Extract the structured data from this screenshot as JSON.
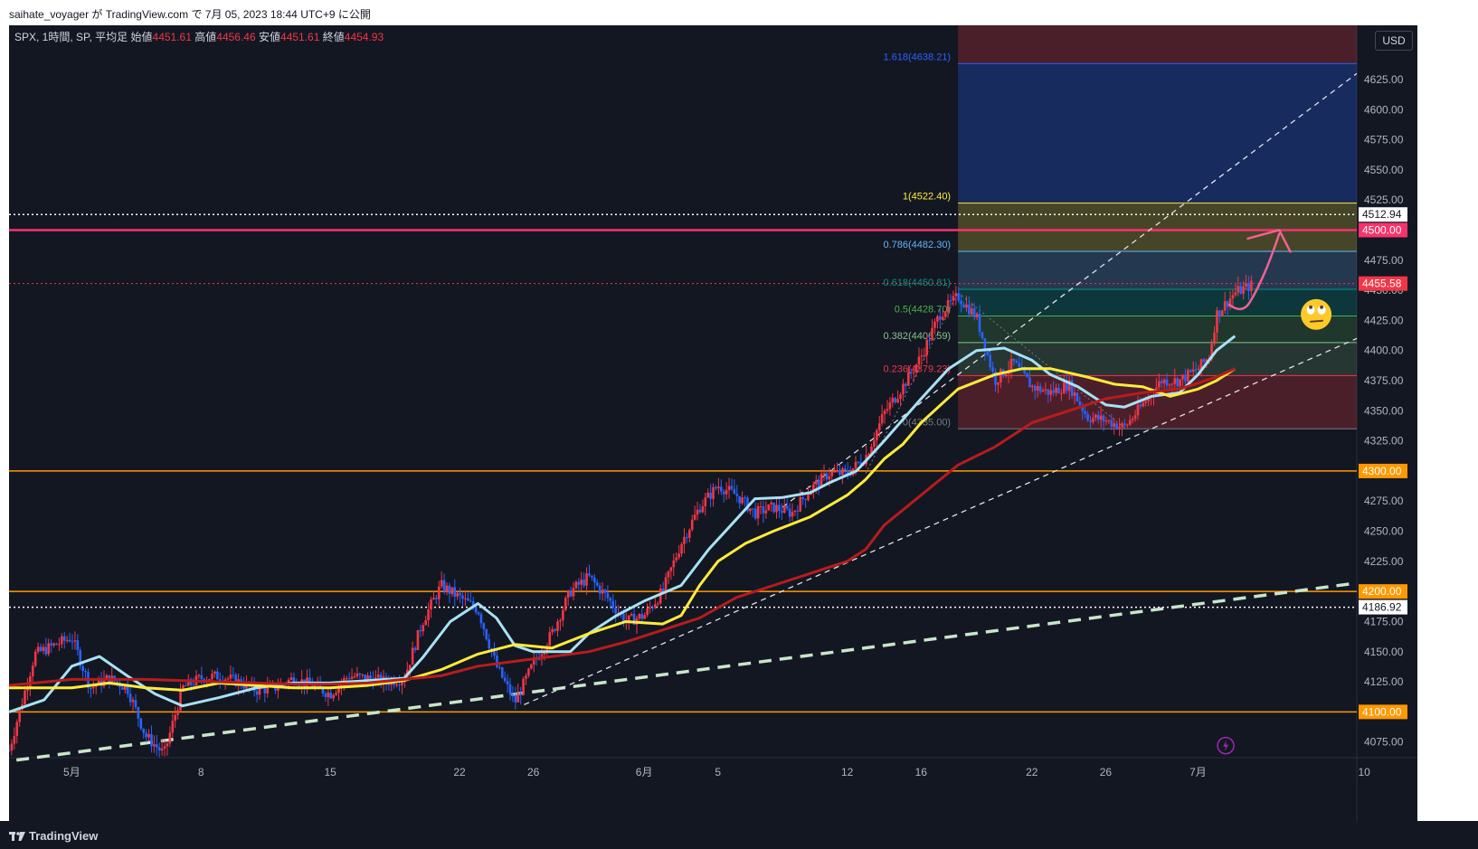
{
  "header": {
    "publish_line": "saihate_voyager が TradingView.com で 7月 05, 2023 18:44 UTC+9 に公開"
  },
  "legend": {
    "symbol": "SPX, 1時間, SP, 平均足",
    "open_label": "始値",
    "open_value": "4451.61",
    "high_label": "高値",
    "high_value": "4456.46",
    "low_label": "安値",
    "low_value": "4451.61",
    "close_label": "終値",
    "close_value": "4454.93"
  },
  "currency": "USD",
  "footer": {
    "brand": "TradingView"
  },
  "colors": {
    "background": "#131722",
    "up": "#f23645",
    "down": "#2962ff",
    "ma_fast": "#a7e2f5",
    "ma_mid": "#ffeb3b",
    "ma_slow": "#b71c1c",
    "support": "#ff9800",
    "resistance": "#f7336d",
    "trend": "#c8e6c9",
    "arrow": "#f06292"
  },
  "chart_data": {
    "type": "candlestick",
    "y_axis": {
      "range": [
        4062,
        4670
      ],
      "ticks": [
        4075,
        4100,
        4125,
        4150,
        4175,
        4200,
        4225,
        4250,
        4275,
        4300,
        4325,
        4350,
        4375,
        4400,
        4425,
        4450,
        4475,
        4500,
        4525,
        4550,
        4575,
        4600,
        4625
      ],
      "tick_labels": [
        "4075.00",
        "4100.00",
        "4125.00",
        "4150.00",
        "4175.00",
        "4200.00",
        "4225.00",
        "4250.00",
        "4275.00",
        "4300.00",
        "4325.00",
        "4350.00",
        "4375.00",
        "4400.00",
        "4425.00",
        "4450.00",
        "4475.00",
        "4500.00",
        "4525.00",
        "4550.00",
        "4575.00",
        "4600.00",
        "4625.00"
      ]
    },
    "x_axis": {
      "range_days": [
        -3.4,
        69.6
      ],
      "ticks": [
        {
          "day": 0,
          "label": "5月"
        },
        {
          "day": 7,
          "label": "8"
        },
        {
          "day": 14,
          "label": "15"
        },
        {
          "day": 21,
          "label": "22"
        },
        {
          "day": 25,
          "label": "26"
        },
        {
          "day": 31,
          "label": "6月"
        },
        {
          "day": 35,
          "label": "5"
        },
        {
          "day": 42,
          "label": "12"
        },
        {
          "day": 46,
          "label": "16"
        },
        {
          "day": 52,
          "label": "22"
        },
        {
          "day": 56,
          "label": "26"
        },
        {
          "day": 61,
          "label": "7月"
        },
        {
          "day": 70,
          "label": "10"
        }
      ]
    },
    "price_path": [
      {
        "d": -3.4,
        "p": 4068
      },
      {
        "d": -2,
        "p": 4148
      },
      {
        "d": 0,
        "p": 4162
      },
      {
        "d": 1,
        "p": 4120
      },
      {
        "d": 2,
        "p": 4128
      },
      {
        "d": 3,
        "p": 4120
      },
      {
        "d": 4,
        "p": 4080
      },
      {
        "d": 5,
        "p": 4065
      },
      {
        "d": 6,
        "p": 4120
      },
      {
        "d": 7,
        "p": 4128
      },
      {
        "d": 8,
        "p": 4130
      },
      {
        "d": 9,
        "p": 4125
      },
      {
        "d": 10,
        "p": 4118
      },
      {
        "d": 11,
        "p": 4120
      },
      {
        "d": 12,
        "p": 4128
      },
      {
        "d": 13,
        "p": 4122
      },
      {
        "d": 14,
        "p": 4115
      },
      {
        "d": 15,
        "p": 4130
      },
      {
        "d": 16,
        "p": 4128
      },
      {
        "d": 17,
        "p": 4125
      },
      {
        "d": 18,
        "p": 4128
      },
      {
        "d": 19,
        "p": 4175
      },
      {
        "d": 20,
        "p": 4205
      },
      {
        "d": 21,
        "p": 4195
      },
      {
        "d": 22,
        "p": 4185
      },
      {
        "d": 23,
        "p": 4138
      },
      {
        "d": 24,
        "p": 4108
      },
      {
        "d": 25,
        "p": 4140
      },
      {
        "d": 26,
        "p": 4165
      },
      {
        "d": 27,
        "p": 4200
      },
      {
        "d": 28,
        "p": 4212
      },
      {
        "d": 29,
        "p": 4195
      },
      {
        "d": 30,
        "p": 4175
      },
      {
        "d": 31,
        "p": 4180
      },
      {
        "d": 32,
        "p": 4200
      },
      {
        "d": 33,
        "p": 4240
      },
      {
        "d": 34,
        "p": 4270
      },
      {
        "d": 35,
        "p": 4288
      },
      {
        "d": 36,
        "p": 4280
      },
      {
        "d": 37,
        "p": 4265
      },
      {
        "d": 38,
        "p": 4270
      },
      {
        "d": 39,
        "p": 4265
      },
      {
        "d": 40,
        "p": 4285
      },
      {
        "d": 41,
        "p": 4298
      },
      {
        "d": 42,
        "p": 4298
      },
      {
        "d": 43,
        "p": 4312
      },
      {
        "d": 44,
        "p": 4348
      },
      {
        "d": 45,
        "p": 4370
      },
      {
        "d": 46,
        "p": 4395
      },
      {
        "d": 47,
        "p": 4430
      },
      {
        "d": 48,
        "p": 4445
      },
      {
        "d": 49,
        "p": 4428
      },
      {
        "d": 50,
        "p": 4375
      },
      {
        "d": 51,
        "p": 4390
      },
      {
        "d": 52,
        "p": 4370
      },
      {
        "d": 53,
        "p": 4365
      },
      {
        "d": 54,
        "p": 4372
      },
      {
        "d": 55,
        "p": 4345
      },
      {
        "d": 56,
        "p": 4342
      },
      {
        "d": 57,
        "p": 4336
      },
      {
        "d": 58,
        "p": 4355
      },
      {
        "d": 59,
        "p": 4375
      },
      {
        "d": 60,
        "p": 4375
      },
      {
        "d": 61,
        "p": 4385
      },
      {
        "d": 61.6,
        "p": 4395
      },
      {
        "d": 62,
        "p": 4430
      },
      {
        "d": 63,
        "p": 4448
      },
      {
        "d": 64,
        "p": 4455
      }
    ],
    "moving_averages": [
      {
        "name": "",
        "color": "#a7e2f5",
        "points": [
          [
            -3.4,
            4100
          ],
          [
            -1.5,
            4110
          ],
          [
            0,
            4138
          ],
          [
            1.5,
            4146
          ],
          [
            3,
            4130
          ],
          [
            4.5,
            4115
          ],
          [
            6,
            4105
          ],
          [
            8,
            4112
          ],
          [
            10,
            4120
          ],
          [
            12,
            4124
          ],
          [
            14,
            4124
          ],
          [
            16,
            4126
          ],
          [
            18,
            4128
          ],
          [
            19,
            4145
          ],
          [
            20.5,
            4175
          ],
          [
            22,
            4190
          ],
          [
            23,
            4178
          ],
          [
            24,
            4155
          ],
          [
            25,
            4150
          ],
          [
            27,
            4150
          ],
          [
            28,
            4165
          ],
          [
            29.5,
            4180
          ],
          [
            31,
            4192
          ],
          [
            33,
            4205
          ],
          [
            34.5,
            4235
          ],
          [
            36,
            4260
          ],
          [
            37,
            4277
          ],
          [
            38.5,
            4278
          ],
          [
            40,
            4282
          ],
          [
            41,
            4290
          ],
          [
            42.5,
            4300
          ],
          [
            44,
            4325
          ],
          [
            46,
            4360
          ],
          [
            47.5,
            4385
          ],
          [
            49,
            4400
          ],
          [
            50.5,
            4402
          ],
          [
            52,
            4392
          ],
          [
            53,
            4380
          ],
          [
            54.5,
            4370
          ],
          [
            56,
            4355
          ],
          [
            57,
            4353
          ],
          [
            58.5,
            4362
          ],
          [
            60,
            4365
          ],
          [
            61,
            4380
          ],
          [
            62,
            4400
          ],
          [
            63,
            4412
          ]
        ]
      },
      {
        "name": "",
        "color": "#ffeb3b",
        "points": [
          [
            -3.4,
            4120
          ],
          [
            0,
            4120
          ],
          [
            2,
            4124
          ],
          [
            4,
            4120
          ],
          [
            6,
            4118
          ],
          [
            8,
            4124
          ],
          [
            10,
            4122
          ],
          [
            12,
            4120
          ],
          [
            14,
            4120
          ],
          [
            16,
            4122
          ],
          [
            18,
            4126
          ],
          [
            20,
            4135
          ],
          [
            22,
            4148
          ],
          [
            24,
            4156
          ],
          [
            26,
            4153
          ],
          [
            28,
            4165
          ],
          [
            30,
            4175
          ],
          [
            32,
            4173
          ],
          [
            33,
            4180
          ],
          [
            34,
            4205
          ],
          [
            35,
            4225
          ],
          [
            36.5,
            4240
          ],
          [
            38,
            4250
          ],
          [
            40,
            4262
          ],
          [
            42,
            4280
          ],
          [
            43,
            4293
          ],
          [
            44,
            4310
          ],
          [
            45,
            4322
          ],
          [
            46,
            4340
          ],
          [
            48,
            4368
          ],
          [
            50,
            4380
          ],
          [
            51.5,
            4385
          ],
          [
            53,
            4385
          ],
          [
            55,
            4378
          ],
          [
            56.5,
            4372
          ],
          [
            58,
            4370
          ],
          [
            59.5,
            4362
          ],
          [
            61,
            4368
          ],
          [
            62,
            4375
          ],
          [
            63,
            4385
          ]
        ]
      },
      {
        "name": "",
        "color": "#b71c1c",
        "points": [
          [
            -3.4,
            4122
          ],
          [
            0,
            4127
          ],
          [
            2,
            4127
          ],
          [
            4,
            4127
          ],
          [
            6,
            4126
          ],
          [
            8,
            4125
          ],
          [
            10,
            4124
          ],
          [
            12,
            4123
          ],
          [
            14,
            4123
          ],
          [
            16,
            4124
          ],
          [
            18,
            4127
          ],
          [
            20,
            4130
          ],
          [
            22,
            4138
          ],
          [
            24,
            4142
          ],
          [
            26,
            4146
          ],
          [
            28,
            4150
          ],
          [
            30,
            4158
          ],
          [
            32,
            4168
          ],
          [
            34,
            4178
          ],
          [
            36,
            4195
          ],
          [
            38,
            4205
          ],
          [
            40,
            4215
          ],
          [
            42,
            4225
          ],
          [
            43,
            4235
          ],
          [
            44,
            4255
          ],
          [
            46,
            4280
          ],
          [
            48,
            4305
          ],
          [
            50,
            4320
          ],
          [
            52,
            4340
          ],
          [
            54,
            4350
          ],
          [
            56,
            4360
          ],
          [
            58,
            4365
          ],
          [
            60,
            4368
          ],
          [
            62,
            4378
          ],
          [
            63,
            4385
          ]
        ]
      }
    ],
    "fibonacci": {
      "day_start": 48.0,
      "day_end": 69.6,
      "levels": [
        {
          "ratio": "1.618",
          "price": 4638.21,
          "label": "1.618(4638.21)",
          "color": "#2962ff"
        },
        {
          "ratio": "1",
          "price": 4522.4,
          "label": "1(4522.40)",
          "color": "#ffeb3b"
        },
        {
          "ratio": "0.786",
          "price": 4482.3,
          "label": "0.786(4482.30)",
          "color": "#64b5f6"
        },
        {
          "ratio": "0.618",
          "price": 4450.81,
          "label": "0.618(4450.81)",
          "color": "#009688"
        },
        {
          "ratio": "0.5",
          "price": 4428.7,
          "label": "0.5(4428.70)",
          "color": "#4caf50"
        },
        {
          "ratio": "0.382",
          "price": 4406.59,
          "label": "0.382(4406.59)",
          "color": "#81c784"
        },
        {
          "ratio": "0.236",
          "price": 4379.23,
          "label": "0.236(4379.23)",
          "color": "#f23645"
        },
        {
          "ratio": "0",
          "price": 4335.0,
          "label": "0(4335.00)",
          "color": "#787b86"
        }
      ]
    },
    "horizontal_levels": [
      {
        "price": 4500.0,
        "label": "4500.00",
        "color": "#f7336d",
        "style": "solid",
        "width": 2.5
      },
      {
        "price": 4300.0,
        "label": "4300.00",
        "color": "#ff9800",
        "style": "solid",
        "width": 1.5
      },
      {
        "price": 4200.0,
        "label": "4200.00",
        "color": "#ff9800",
        "style": "solid",
        "width": 1.5
      },
      {
        "price": 4100.0,
        "label": "4100.00",
        "color": "#ff9800",
        "style": "solid",
        "width": 1.5
      },
      {
        "price": 4512.94,
        "label": "4512.94",
        "color": "#ffffff",
        "style": "dotted",
        "width": 1.5
      },
      {
        "price": 4186.92,
        "label": "4186.92",
        "color": "#ffffff",
        "style": "dotted",
        "width": 1.5
      },
      {
        "price": 4455.58,
        "label": "4455.58",
        "color": "#f23645",
        "style": "dotted",
        "width": 1
      }
    ],
    "trend_lines": [
      {
        "from": [
          -3,
          4060
        ],
        "to": [
          69.6,
          4207
        ],
        "color": "#c8e6c9",
        "width": 3.5,
        "dash": "14 9"
      },
      {
        "from": [
          24.5,
          4106
        ],
        "to": [
          69.6,
          4410
        ],
        "color": "#e0e3eb",
        "width": 1.3,
        "dash": "6 5"
      },
      {
        "from": [
          38.5,
          4270
        ],
        "to": [
          69.6,
          4630
        ],
        "color": "#e0e3eb",
        "width": 1.3,
        "dash": "6 5"
      }
    ]
  }
}
